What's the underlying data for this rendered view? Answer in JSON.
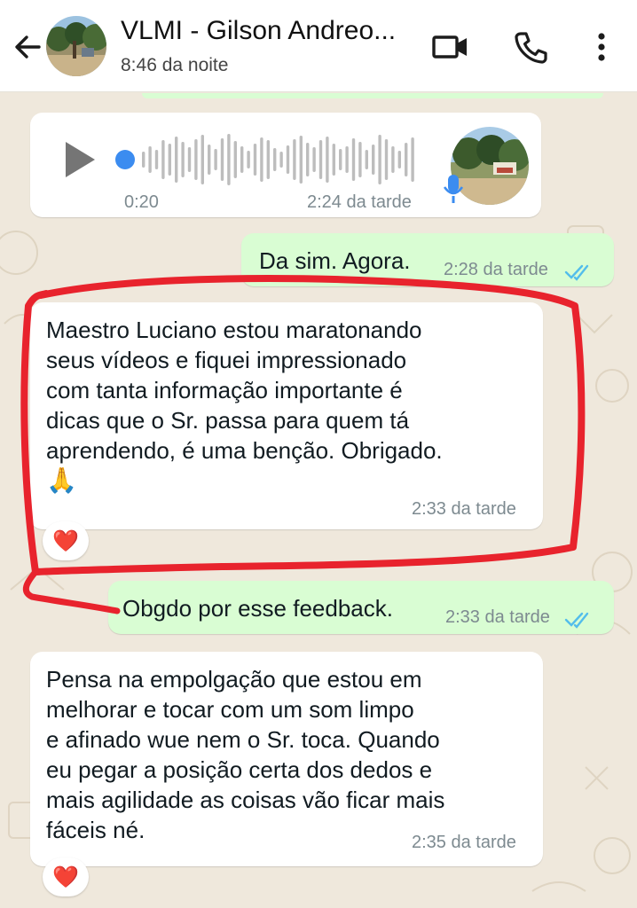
{
  "header": {
    "title": "VLMI - Gilson Andreo...",
    "subtitle": "8:46 da noite",
    "icons": [
      "back-arrow-icon",
      "video-call-icon",
      "phone-icon",
      "more-vert-icon"
    ]
  },
  "colors": {
    "incoming_bubble": "#ffffff",
    "outgoing_bubble": "#d9fdd3",
    "read_ticks": "#53bdeb",
    "annotation": "#e8232d",
    "voice_dot": "#3b8cf0"
  },
  "messages": [
    {
      "type": "voice",
      "direction": "incoming",
      "duration": "0:20",
      "time": "2:24 da tarde",
      "mic_icon": "microphone-icon"
    },
    {
      "type": "text",
      "direction": "outgoing",
      "text": "Da sim. Agora.",
      "time": "2:28 da tarde",
      "status": "read"
    },
    {
      "type": "text",
      "direction": "incoming",
      "lines": [
        "Maestro Luciano  estou maratonando",
        "seus vídeos e fiquei impressionado",
        "com tanta informação importante é",
        "dicas que o Sr. passa para quem tá",
        "aprendendo, é uma benção. Obrigado.",
        "🙏"
      ],
      "time": "2:33 da tarde",
      "reaction": "❤️"
    },
    {
      "type": "text",
      "direction": "outgoing",
      "text": "Obgdo por esse feedback.",
      "time": "2:33 da tarde",
      "status": "read"
    },
    {
      "type": "text",
      "direction": "incoming",
      "lines": [
        "Pensa na empolgação que estou em",
        "melhorar e tocar com um som limpo",
        "e afinado wue nem o Sr. toca. Quando",
        "eu pegar a posição certa dos dedos e",
        "mais agilidade  as coisas vão ficar mais",
        "fáceis né."
      ],
      "time": "2:35 da tarde",
      "reaction": "❤️"
    }
  ]
}
